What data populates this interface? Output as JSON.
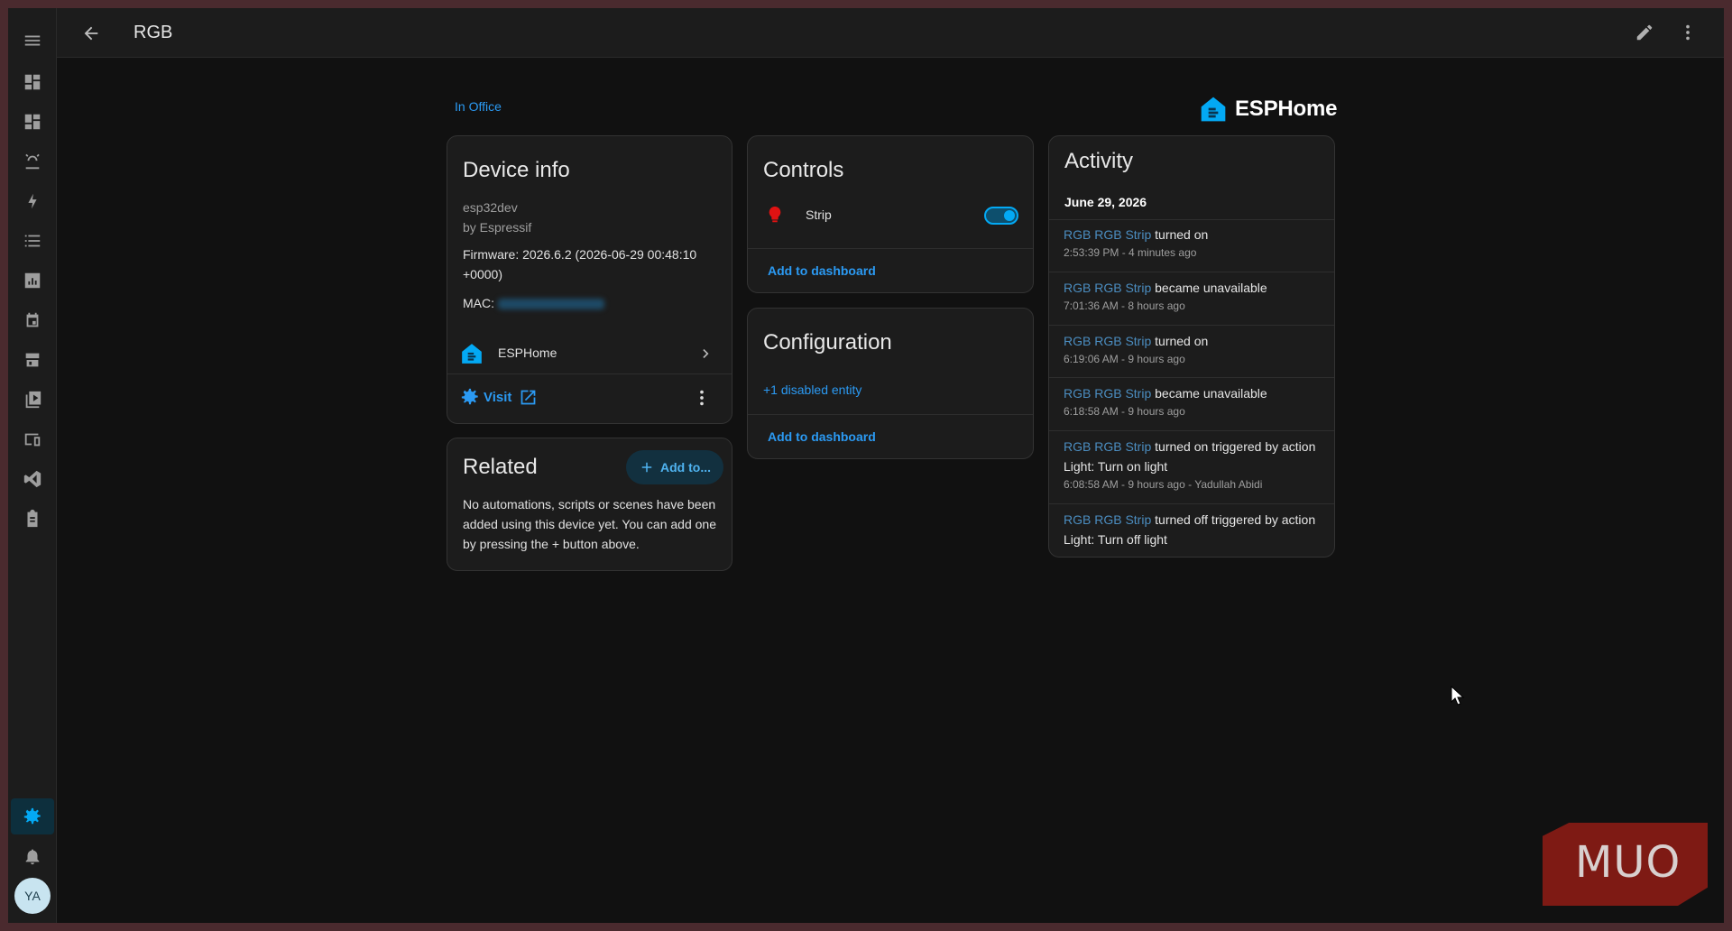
{
  "topbar": {
    "title": "RGB"
  },
  "area_link": "In Office",
  "brand": {
    "name": "ESPHome",
    "color": "#03a9f4"
  },
  "device_info": {
    "title": "Device info",
    "model": "esp32dev",
    "manufacturer": "by Espressif",
    "firmware": "Firmware: 2026.6.2 (2026-06-29 00:48:10 +0000)",
    "mac_label": "MAC:",
    "integration": "ESPHome",
    "visit_label": "Visit"
  },
  "related": {
    "title": "Related",
    "add_button": "Add to...",
    "text": "No automations, scripts or scenes have been added using this device yet. You can add one by pressing the + button above."
  },
  "controls": {
    "title": "Controls",
    "entity_name": "Strip",
    "toggle_on": true,
    "add_dashboard": "Add to dashboard"
  },
  "configuration": {
    "title": "Configuration",
    "disabled_entities": "+1 disabled entity",
    "add_dashboard": "Add to dashboard"
  },
  "activity": {
    "title": "Activity",
    "date": "June 29, 2026",
    "entries": [
      {
        "entity": "RGB RGB Strip",
        "action": "turned on",
        "action2": "",
        "time": "2:53:39 PM - 4 minutes ago"
      },
      {
        "entity": "RGB RGB Strip",
        "action": "became unavailable",
        "action2": "",
        "time": "7:01:36 AM - 8 hours ago"
      },
      {
        "entity": "RGB RGB Strip",
        "action": "turned on",
        "action2": "",
        "time": "6:19:06 AM - 9 hours ago"
      },
      {
        "entity": "RGB RGB Strip",
        "action": "became unavailable",
        "action2": "",
        "time": "6:18:58 AM - 9 hours ago"
      },
      {
        "entity": "RGB RGB Strip",
        "action": "turned on triggered by action",
        "action2": "Light: Turn on light",
        "time": "6:08:58 AM - 9 hours ago - Yadullah Abidi"
      },
      {
        "entity": "RGB RGB Strip",
        "action": "turned off triggered by action",
        "action2": "Light: Turn off light",
        "time": ""
      }
    ]
  },
  "user": {
    "initials": "YA"
  },
  "watermark": "MUO",
  "colors": {
    "accent": "#03a9f4",
    "background": "#111111",
    "card": "#1c1c1c"
  }
}
